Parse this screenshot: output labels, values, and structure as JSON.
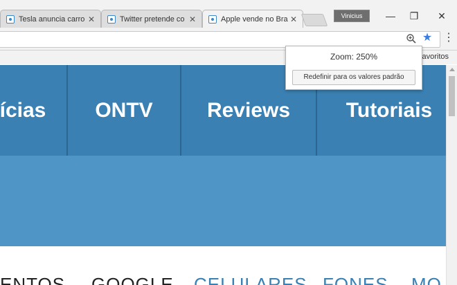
{
  "tabs": [
    {
      "title": "Tesla anuncia carro",
      "close": "✕"
    },
    {
      "title": "Twitter pretende co",
      "close": "✕"
    },
    {
      "title": "Apple vende no Bra",
      "close": "✕"
    }
  ],
  "profile": {
    "name": "Vinicius"
  },
  "window": {
    "minimize": "—",
    "restore": "❐",
    "close": "✕"
  },
  "toolbar": {
    "star_glyph": "★",
    "menu_glyph": "⋮"
  },
  "bookmarks": {
    "label": "favoritos"
  },
  "zoom": {
    "label": "Zoom: 250%",
    "reset_label": "Redefinir para os valores padrão"
  },
  "nav": {
    "items": [
      "ícias",
      "ONTV",
      "Reviews",
      "Tutoriais"
    ]
  },
  "categories": [
    {
      "label": "ENTOS",
      "color": "#222222"
    },
    {
      "label": "GOOGLE",
      "color": "#222222"
    },
    {
      "label": "CELULARES",
      "color": "#3b80b3"
    },
    {
      "label": "FONES",
      "color": "#3b80b3"
    },
    {
      "label": "MO",
      "color": "#3b80b3"
    }
  ],
  "colors": {
    "nav": "#3b80b3",
    "hero": "#4f95c6",
    "accent": "#3b7ddd"
  }
}
